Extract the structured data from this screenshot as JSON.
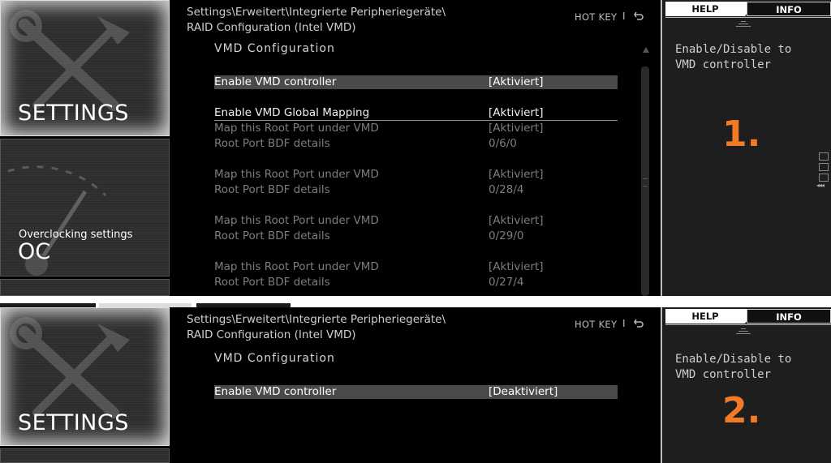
{
  "panels": [
    {
      "nav": {
        "settings_title": "SETTINGS",
        "oc_subtitle": "Overclocking settings",
        "oc_title": "OC"
      },
      "breadcrumb": {
        "line1": "Settings\\Erweitert\\Integrierte Peripheriegeräte\\",
        "line2": "RAID Configuration (Intel VMD)"
      },
      "hotkey": {
        "label": "HOT KEY",
        "separator": "I"
      },
      "section_title": "VMD  Configuration",
      "rows": [
        {
          "label": "Enable VMD controller",
          "value": "[Aktiviert]"
        },
        {
          "label": "Enable VMD Global Mapping",
          "value": "[Aktiviert]"
        },
        {
          "label": "Map this Root Port under VMD",
          "value": "[Aktiviert]"
        },
        {
          "label": "Root Port BDF details",
          "value": "0/6/0"
        },
        {
          "label": "Map this Root Port under VMD",
          "value": "[Aktiviert]"
        },
        {
          "label": "Root Port BDF details",
          "value": "0/28/4"
        },
        {
          "label": "Map this Root Port under VMD",
          "value": "[Aktiviert]"
        },
        {
          "label": "Root Port BDF details",
          "value": "0/29/0"
        },
        {
          "label": "Map this Root Port under VMD",
          "value": "[Aktiviert]"
        },
        {
          "label": "Root Port BDF details",
          "value": "0/27/4"
        }
      ],
      "help": {
        "tab_help": "HELP",
        "tab_info": "INFO",
        "text_line1": "Enable/Disable to",
        "text_line2": "VMD controller",
        "marker": "1."
      }
    },
    {
      "nav": {
        "settings_title": "SETTINGS"
      },
      "breadcrumb": {
        "line1": "Settings\\Erweitert\\Integrierte Peripheriegeräte\\",
        "line2": "RAID Configuration (Intel VMD)"
      },
      "hotkey": {
        "label": "HOT KEY",
        "separator": "I"
      },
      "section_title": "VMD  Configuration",
      "rows": [
        {
          "label": "Enable VMD controller",
          "value": "[Deaktiviert]"
        }
      ],
      "help": {
        "tab_help": "HELP",
        "tab_info": "INFO",
        "text_line1": "Enable/Disable to",
        "text_line2": "VMD controller",
        "marker": "2."
      }
    }
  ],
  "colors": {
    "marker": "#f07a26",
    "selected_row": "#4a4a4a",
    "help_bg": "#1e1e1e"
  },
  "icons": [
    "tools-icon",
    "gauge-icon",
    "back-arrow-icon"
  ]
}
